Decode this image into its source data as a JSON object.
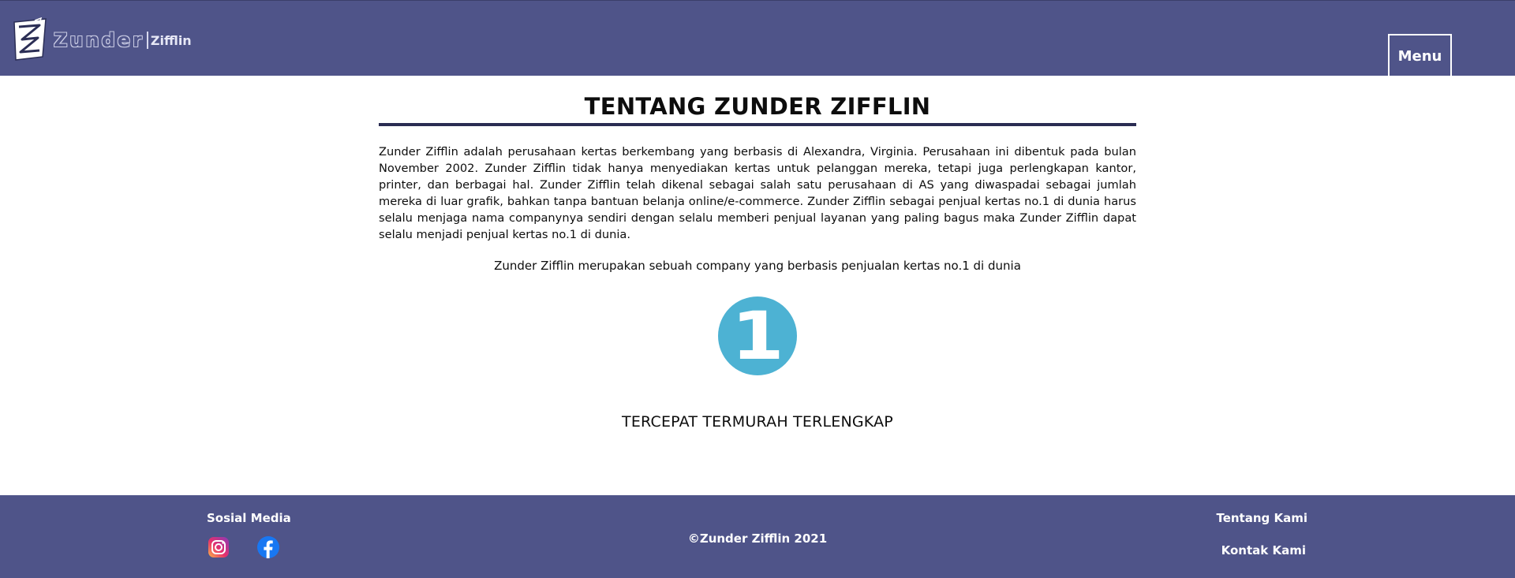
{
  "header": {
    "logo_main": "Zunder",
    "logo_sub": "Zifflin",
    "menu_label": "Menu"
  },
  "main": {
    "title": "TENTANG ZUNDER ZIFFLIN",
    "paragraph": "Zunder Zifflin adalah perusahaan kertas berkembang yang berbasis di Alexandra, Virginia. Perusahaan ini dibentuk pada bulan November 2002. Zunder Zifflin tidak hanya menyediakan kertas untuk pelanggan mereka, tetapi juga perlengkapan kantor, printer, dan berbagai hal. Zunder Zifflin telah dikenal sebagai salah satu perusahaan di AS yang diwaspadai sebagai jumlah mereka di luar grafik, bahkan tanpa bantuan belanja online/e-commerce. Zunder Zifflin sebagai penjual kertas no.1 di dunia harus selalu menjaga nama companynya sendiri dengan selalu memberi penjual layanan yang paling bagus maka Zunder Zifflin dapat selalu menjadi penjual kertas no.1 di dunia.",
    "tagline": "Zunder Zifflin merupakan sebuah company yang berbasis penjualan kertas no.1 di dunia",
    "badge_number": "1",
    "slogan": "TERCEPAT TERMURAH TERLENGKAP"
  },
  "footer": {
    "social_title": "Sosial Media",
    "social_icons": [
      "instagram-icon",
      "facebook-icon"
    ],
    "copyright": "©Zunder Zifflin 2021",
    "links": [
      "Tentang Kami",
      "Kontak Kami"
    ]
  },
  "colors": {
    "header_bg": "#4f5489",
    "footer_bg": "#4f5489",
    "title_rule": "#2a2c52",
    "badge": "#4db2d3"
  }
}
